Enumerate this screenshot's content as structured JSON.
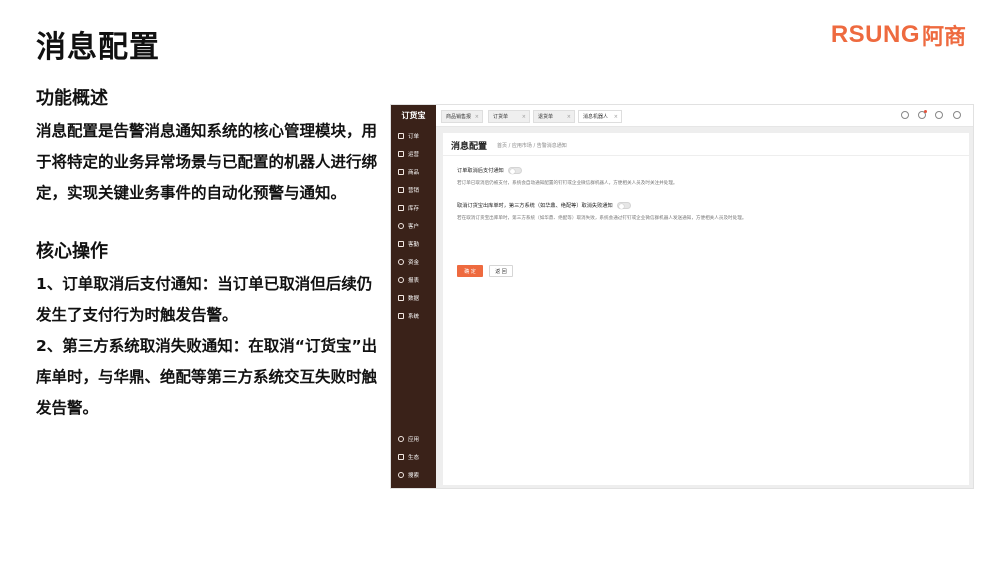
{
  "slide": {
    "title": "消息配置",
    "logo_text": "RSUNG",
    "logo_cn": "阿商",
    "overview_heading": "功能概述",
    "overview_lead": "消息配置",
    "overview_text": "是告警消息通知系统的核心管理模块，用于将特定的业务异常场景与已配置的机器人进行绑定，实现关键业务事件的自动化预警与通知。",
    "ops_heading": "核心操作",
    "op1_title": "1、订单取消后支付通知",
    "op1_text": "：当订单已取消但后续仍发生了支付行为时触发告警。",
    "op2_title": "2、第三方系统取消失败通知",
    "op2_text": "：在取消“订货宝”出库单时，与华鼎、绝配等第三方系统交互失败时触发告警。"
  },
  "app": {
    "brand": "订货宝",
    "sidebar": [
      {
        "label": "订单",
        "icon": "order-icon"
      },
      {
        "label": "运营",
        "icon": "operation-icon"
      },
      {
        "label": "商品",
        "icon": "goods-icon"
      },
      {
        "label": "营销",
        "icon": "marketing-icon"
      },
      {
        "label": "库存",
        "icon": "inventory-icon"
      },
      {
        "label": "客户",
        "icon": "customer-icon"
      },
      {
        "label": "客勤",
        "icon": "service-icon"
      },
      {
        "label": "资金",
        "icon": "funds-icon"
      },
      {
        "label": "报表",
        "icon": "report-icon"
      },
      {
        "label": "数据",
        "icon": "data-icon"
      },
      {
        "label": "系统",
        "icon": "system-icon"
      }
    ],
    "sidebar_bottom": [
      {
        "label": "应用",
        "icon": "apps-icon"
      },
      {
        "label": "生态",
        "icon": "ecosystem-icon"
      },
      {
        "label": "搜索",
        "icon": "search-icon"
      }
    ],
    "tabs": [
      {
        "label": "商品销售报"
      },
      {
        "label": "订货单"
      },
      {
        "label": "退货单"
      },
      {
        "label": "消息机器人"
      }
    ],
    "page_title": "消息配置",
    "breadcrumb": "首页 / 应用市场 / 告警消息通知",
    "option1_label": "订单取消后支付通知",
    "option1_desc": "若订单已取消后仍被支付，系统会自动通知配置的钉钉或企业微信群机器人，方便相关人员及时关注并处理。",
    "option2_label": "取消订货宝出库单时，第三方系统（如华鼎、绝配等）取消失败通知",
    "option2_desc": "若在取消订货宝出库单时，第三方系统（如华鼎、绝配等）取消失败，系统会通过钉钉或企业微信群机器人发送通知，方便相关人员及时处理。",
    "confirm": "确 定",
    "back": "返 回"
  },
  "colors": {
    "accent": "#ee6a3f",
    "sidebar": "#3a2219"
  }
}
